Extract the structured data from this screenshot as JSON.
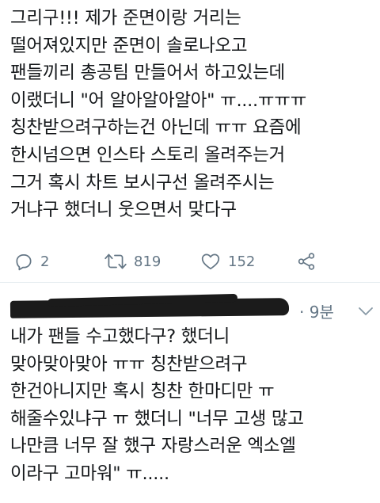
{
  "tweet1": {
    "lines": [
      "그리구!!! 제가 준면이랑 거리는",
      "떨어져있지만 준면이 솔로나오고",
      "팬들끼리 총공팀 만들어서 하고있는데",
      "이랬더니 \"어 알아알아알아\" ㅠ....ㅠㅠㅠ",
      "칭찬받으려구하는건 아닌데 ㅠㅠ 요즘에",
      "한시넘으면 인스타 스토리 올려주는거",
      "그거 혹시 차트 보시구선 올려주시는",
      "거냐구 했더니 웃으면서 맞다구"
    ],
    "actions": {
      "reply_count": "2",
      "retweet_count": "819",
      "like_count": "152"
    }
  },
  "tweet2": {
    "time": "· 9분",
    "lines": [
      "내가 팬들 수고했다구? 했더니",
      "맞아맞아맞아 ㅠㅠ 칭찬받으려구",
      "한건아니지만 혹시 칭찬 한마디만 ㅠ",
      "해줄수있냐구 ㅠ 했더니 \"너무 고생 많고",
      "나만큼 너무 잘 했구 자랑스러운 엑소엘",
      "이라구 고마워\" ㅠ....."
    ]
  },
  "colors": {
    "text": "#14171a",
    "secondary": "#657786",
    "divider": "#e6ecf0"
  },
  "icons": [
    "reply-icon",
    "retweet-icon",
    "like-icon",
    "share-icon",
    "chevron-down-icon"
  ]
}
